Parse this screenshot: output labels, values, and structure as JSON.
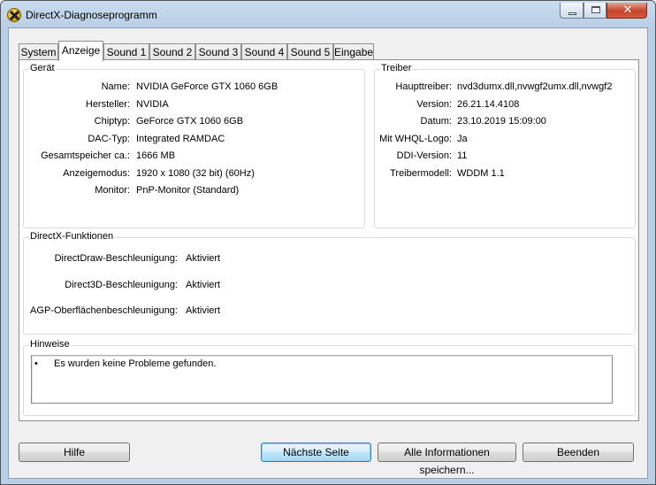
{
  "window": {
    "title": "DirectX-Diagnoseprogramm",
    "close_glyph": "✕"
  },
  "tabs": [
    {
      "label": "System"
    },
    {
      "label": "Anzeige",
      "active": true
    },
    {
      "label": "Sound 1"
    },
    {
      "label": "Sound 2"
    },
    {
      "label": "Sound 3"
    },
    {
      "label": "Sound 4"
    },
    {
      "label": "Sound 5"
    },
    {
      "label": "Eingabe"
    }
  ],
  "geraet": {
    "title": "Gerät",
    "rows": [
      {
        "label": "Name:",
        "value": "NVIDIA GeForce GTX 1060 6GB"
      },
      {
        "label": "Hersteller:",
        "value": "NVIDIA"
      },
      {
        "label": "Chiptyp:",
        "value": "GeForce GTX 1060 6GB"
      },
      {
        "label": "DAC-Typ:",
        "value": "Integrated RAMDAC"
      },
      {
        "label": "Gesamtspeicher ca.:",
        "value": "1666 MB"
      },
      {
        "label": "Anzeigemodus:",
        "value": "1920 x 1080 (32 bit) (60Hz)"
      },
      {
        "label": "Monitor:",
        "value": "PnP-Monitor (Standard)"
      }
    ]
  },
  "treiber": {
    "title": "Treiber",
    "rows": [
      {
        "label": "Haupttreiber:",
        "value": "nvd3dumx.dll,nvwgf2umx.dll,nvwgf2"
      },
      {
        "label": "Version:",
        "value": "26.21.14.4108"
      },
      {
        "label": "Datum:",
        "value": "23.10.2019 15:09:00"
      },
      {
        "label": "Mit WHQL-Logo:",
        "value": "Ja"
      },
      {
        "label": "DDI-Version:",
        "value": "11"
      },
      {
        "label": "Treibermodell:",
        "value": "WDDM 1.1"
      }
    ]
  },
  "directx": {
    "title": "DirectX-Funktionen",
    "rows": [
      {
        "label": "DirectDraw-Beschleunigung:",
        "value": "Aktiviert"
      },
      {
        "label": "Direct3D-Beschleunigung:",
        "value": "Aktiviert"
      },
      {
        "label": "AGP-Oberflächenbeschleunigung:",
        "value": "Aktiviert"
      }
    ]
  },
  "hinweise": {
    "title": "Hinweise",
    "bullet": "•",
    "text": "Es wurden keine Probleme gefunden."
  },
  "buttons": {
    "help": "Hilfe",
    "next": "Nächste Seite",
    "save_all": "Alle Informationen speichern...",
    "exit": "Beenden"
  }
}
